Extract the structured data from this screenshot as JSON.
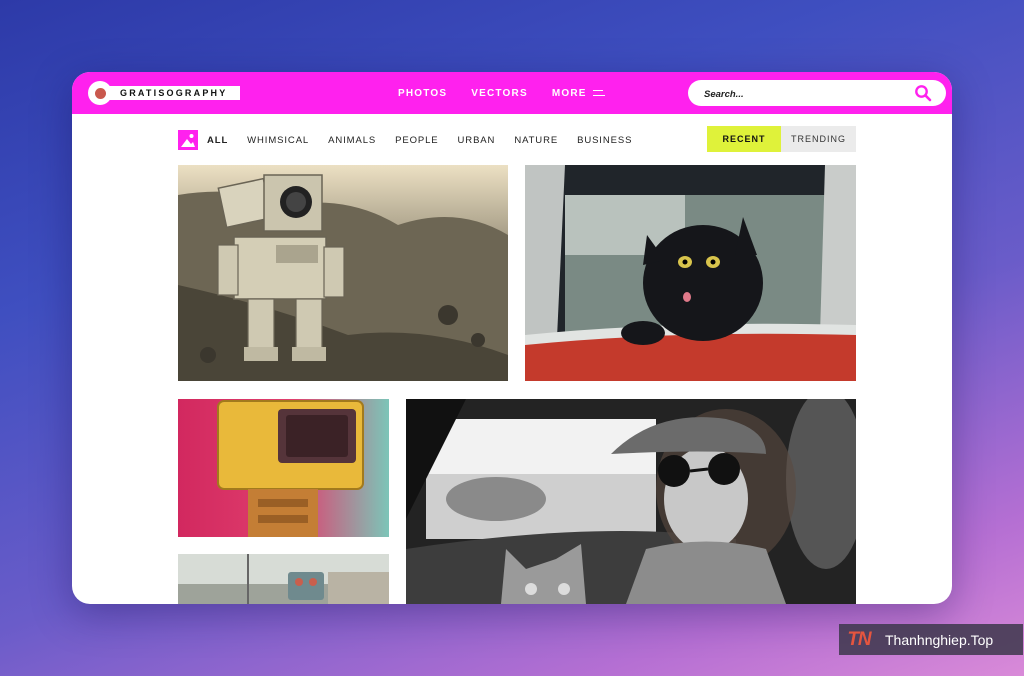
{
  "brand": {
    "name": "GRATISOGRAPHY"
  },
  "nav": {
    "photos": "PHOTOS",
    "vectors": "VECTORS",
    "more": "MORE"
  },
  "search": {
    "placeholder": "Search..."
  },
  "filters": {
    "categories": [
      "ALL",
      "WHIMSICAL",
      "ANIMALS",
      "PEOPLE",
      "URBAN",
      "NATURE",
      "BUSINESS"
    ],
    "active": "ALL"
  },
  "sort": {
    "recent": "RECENT",
    "trending": "TRENDING",
    "selected": "RECENT"
  },
  "photos": [
    {
      "subject": "retro robot on rocky ground"
    },
    {
      "subject": "black cat in red car window"
    },
    {
      "subject": "robot with retro tv head"
    },
    {
      "subject": "woman in sunglasses and hat with cat in car"
    },
    {
      "subject": "small robot on street"
    }
  ],
  "watermark": {
    "text": "Thanhnghiep.Top",
    "badge": "TN"
  },
  "colors": {
    "brand": "#ff21ee",
    "accent": "#dff23a",
    "background_start": "#2d3aa8",
    "background_end": "#d98ad8"
  }
}
